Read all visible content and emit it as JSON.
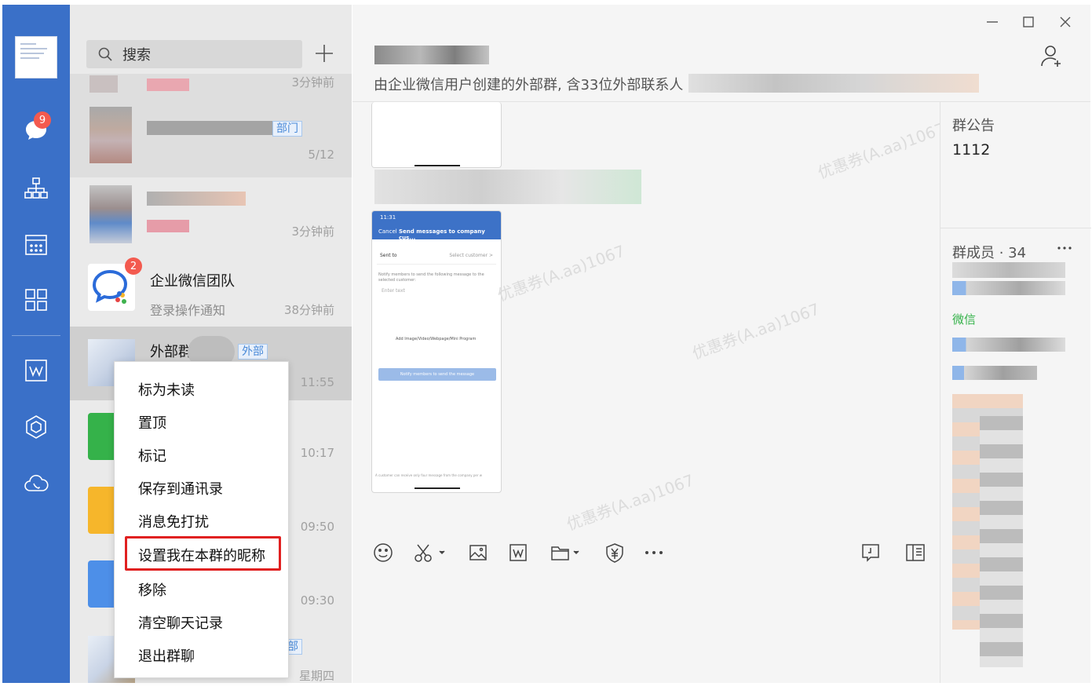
{
  "rail": {
    "chat_badge": "9"
  },
  "list": {
    "search_placeholder": "搜索",
    "items": [
      {
        "time": "3分钟前"
      },
      {
        "tag": "部门",
        "time": "5/12"
      },
      {
        "time": "3分钟前"
      },
      {
        "name": "企业微信团队",
        "preview": "登录操作通知",
        "time": "38分钟前",
        "badge": "2"
      },
      {
        "name": "外部群",
        "tag": "外部",
        "time": "11:55"
      },
      {
        "time": "10:17"
      },
      {
        "time": "09:50"
      },
      {
        "time": "09:30"
      },
      {
        "tag": "外部",
        "time": "星期四"
      }
    ]
  },
  "context_menu": {
    "items": [
      "标为未读",
      "置顶",
      "标记",
      "保存到通讯录",
      "消息免打扰",
      "设置我在本群的昵称",
      "移除",
      "清空聊天记录",
      "退出群聊"
    ],
    "highlighted": "设置我在本群的昵称"
  },
  "chat": {
    "description": "由企业微信用户创建的外部群, 含33位外部联系人",
    "phone": {
      "time": "11:31",
      "cancel": "Cancel",
      "title": "Send messages to company cus...",
      "sent_to": "Sent to",
      "select_customer": "Select customer >",
      "notify_text": "Notify members to send the following message to the selected customer:",
      "enter_text": "Enter text",
      "add_media": "Add Image/Video/Webpage/Mini Program",
      "button": "Notify members to send the message",
      "footer": "A customer can receive only four message from the company per w"
    },
    "watermark": "优惠券(A.aa)1067"
  },
  "toolbar": {
    "icons": [
      "smiley-icon",
      "scissors-icon",
      "image-icon",
      "word-icon",
      "folder-icon",
      "yuan-shield-icon",
      "more-icon",
      "note-icon",
      "sidebar-icon"
    ]
  },
  "group_panel": {
    "notice_label": "群公告",
    "notice_value": "1112",
    "members_label": "群成员 · 34",
    "wechat_label": "微信"
  },
  "colors": {
    "rail_blue": "#3a70c8",
    "badge_red": "#f35a4f",
    "highlight_red": "#e02020",
    "external_tag_blue": "#4a8ad8",
    "wechat_green": "#35b24a"
  }
}
